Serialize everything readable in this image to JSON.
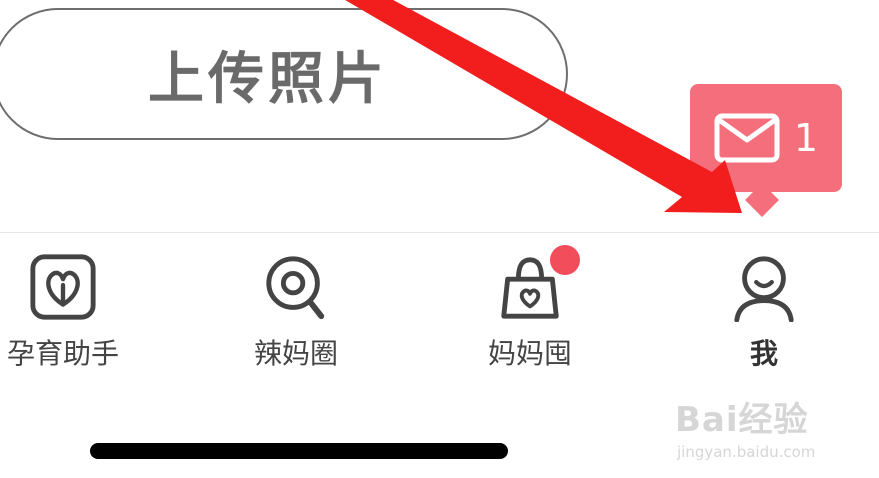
{
  "upload": {
    "label": "上传照片"
  },
  "message_bubble": {
    "count": "1",
    "icon": "envelope-icon",
    "color": "#f46f7b"
  },
  "tabs": [
    {
      "label": "孕育助手",
      "icon": "heart-plant-icon"
    },
    {
      "label": "辣妈圈",
      "icon": "magnifier-circle-icon"
    },
    {
      "label": "妈妈囤",
      "icon": "shopping-bag-heart-icon",
      "badge": true
    },
    {
      "label": "我",
      "icon": "user-smile-icon",
      "active": true
    }
  ],
  "annotation": {
    "arrow_color": "#f21e1e"
  },
  "watermark": {
    "main": "Bai经验",
    "sub": "jingyan.baidu.com"
  }
}
